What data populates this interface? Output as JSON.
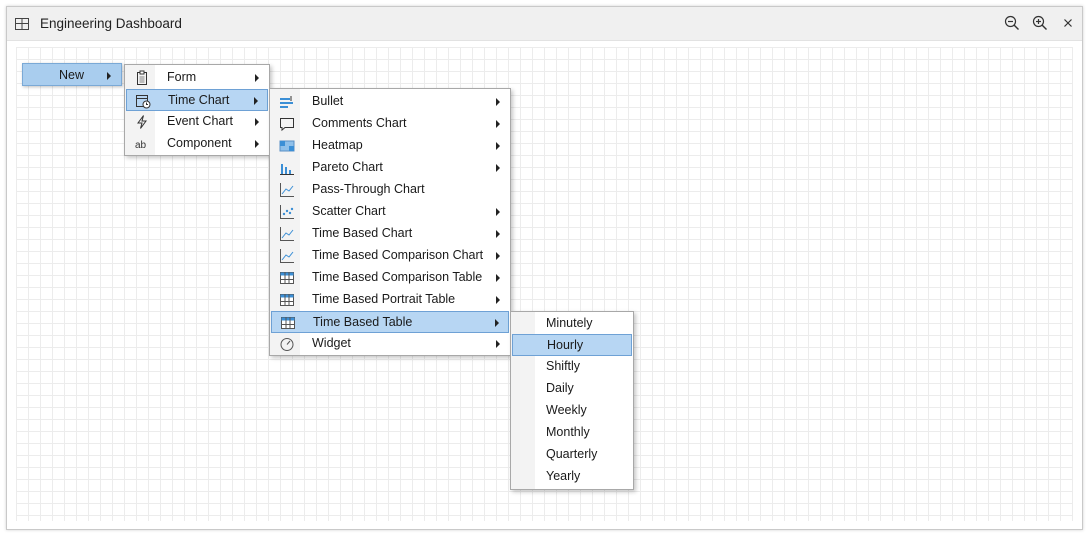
{
  "window": {
    "title": "Engineering Dashboard"
  },
  "new_button": {
    "label": "New"
  },
  "menu1": {
    "items": [
      {
        "label": "Form",
        "icon": "clipboard-icon"
      },
      {
        "label": "Time Chart",
        "icon": "calendar-clock-icon"
      },
      {
        "label": "Event Chart",
        "icon": "lightning-icon"
      },
      {
        "label": "Component",
        "icon": "text-ab-icon"
      }
    ]
  },
  "menu2": {
    "items": [
      {
        "label": "Bullet",
        "icon": "bullet-chart-icon"
      },
      {
        "label": "Comments Chart",
        "icon": "comment-icon"
      },
      {
        "label": "Heatmap",
        "icon": "heatmap-icon"
      },
      {
        "label": "Pareto Chart",
        "icon": "pareto-icon"
      },
      {
        "label": "Pass-Through Chart",
        "icon": "line-chart-icon"
      },
      {
        "label": "Scatter Chart",
        "icon": "scatter-icon"
      },
      {
        "label": "Time Based Chart",
        "icon": "line-chart-icon"
      },
      {
        "label": "Time Based Comparison Chart",
        "icon": "line-chart-icon"
      },
      {
        "label": "Time Based Comparison Table",
        "icon": "table-icon"
      },
      {
        "label": "Time Based Portrait Table",
        "icon": "table-icon"
      },
      {
        "label": "Time Based Table",
        "icon": "table-icon"
      },
      {
        "label": "Widget",
        "icon": "gauge-icon"
      }
    ]
  },
  "menu3": {
    "items": [
      {
        "label": "Minutely"
      },
      {
        "label": "Hourly"
      },
      {
        "label": "Shiftly"
      },
      {
        "label": "Daily"
      },
      {
        "label": "Weekly"
      },
      {
        "label": "Monthly"
      },
      {
        "label": "Quarterly"
      },
      {
        "label": "Yearly"
      }
    ]
  },
  "colors": {
    "selection": "#b7d6f3",
    "selection_border": "#6ea1d5",
    "icon_blue": "#3b8fd6"
  }
}
